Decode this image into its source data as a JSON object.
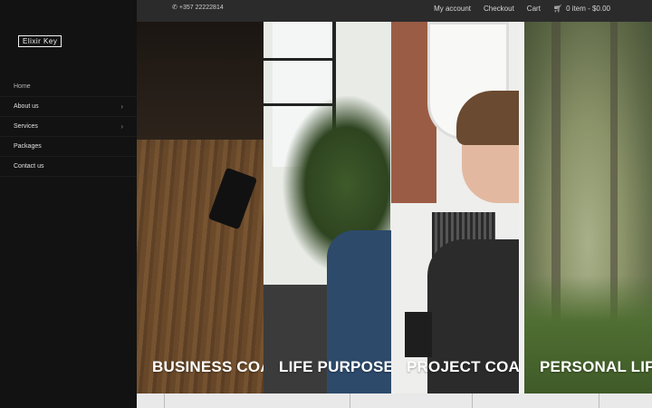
{
  "brand": {
    "logo_text": "Elixir Key"
  },
  "sidebar": {
    "items": [
      {
        "label": "Home",
        "active": true,
        "has_submenu": false
      },
      {
        "label": "About us",
        "active": false,
        "has_submenu": true
      },
      {
        "label": "Services",
        "active": false,
        "has_submenu": true
      },
      {
        "label": "Packages",
        "active": false,
        "has_submenu": false
      },
      {
        "label": "Contact us",
        "active": false,
        "has_submenu": false
      }
    ]
  },
  "topbar": {
    "phone_icon": "phone-icon",
    "phone": "+357 22222814",
    "links": {
      "account": "My account",
      "checkout": "Checkout",
      "cart": "Cart",
      "cart_icon": "shopping-cart-icon",
      "cart_summary": "0 item - $0.00"
    }
  },
  "panels": [
    {
      "title": "BUSINESS COA"
    },
    {
      "title": "LIFE PURPOSE"
    },
    {
      "title": "PROJECT COAC"
    },
    {
      "title": "PERSONAL LIF"
    }
  ],
  "colors": {
    "sidebar_bg": "#121212",
    "topbar_bg": "#2b2b2b",
    "text_light": "#e0e0e0"
  }
}
